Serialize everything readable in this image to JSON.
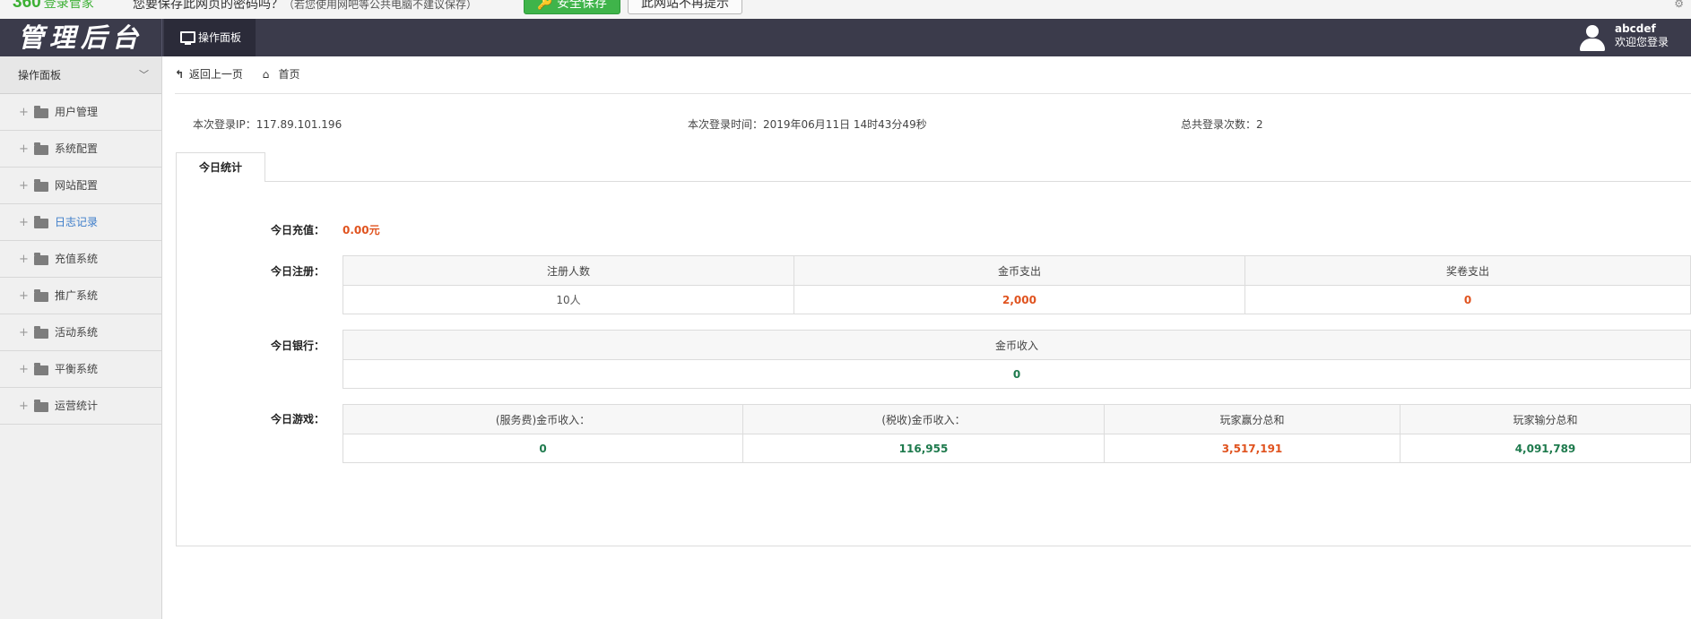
{
  "password_bar": {
    "brand": "360",
    "brand_sub": "登录管家",
    "message": "您要保存此网页的密码吗？",
    "note": "（若您使用网吧等公共电脑不建议保存）",
    "save_button": "安全保存",
    "never_button": "此网站不再提示"
  },
  "header": {
    "logo_text": "管理后台",
    "tab_label": "操作面板",
    "username": "abcdef",
    "welcome": "欢迎您登录"
  },
  "sidebar": {
    "title": "操作面板",
    "items": [
      {
        "label": "用户管理"
      },
      {
        "label": "系统配置"
      },
      {
        "label": "网站配置"
      },
      {
        "label": "日志记录"
      },
      {
        "label": "充值系统"
      },
      {
        "label": "推广系统"
      },
      {
        "label": "活动系统"
      },
      {
        "label": "平衡系统"
      },
      {
        "label": "运营统计"
      }
    ]
  },
  "breadcrumb": {
    "back": "返回上一页",
    "home": "首页"
  },
  "login_info": {
    "ip": "本次登录IP：117.89.101.196",
    "time": "本次登录时间：2019年06月11日 14时43分49秒",
    "count": "总共登录次数：2"
  },
  "tab": {
    "label": "今日统计"
  },
  "stats": {
    "recharge": {
      "label": "今日充值：",
      "value": "0.00元"
    },
    "register": {
      "label": "今日注册：",
      "headers": [
        "注册人数",
        "金币支出",
        "奖卷支出"
      ],
      "values": [
        "10人",
        "2,000",
        "0"
      ]
    },
    "bank": {
      "label": "今日银行：",
      "headers": [
        "金币收入"
      ],
      "values": [
        "0"
      ]
    },
    "game": {
      "label": "今日游戏：",
      "headers": [
        "(服务费)金币收入：",
        "(税收)金币收入：",
        "玩家赢分总和",
        "玩家输分总和"
      ],
      "values": [
        "0",
        "116,955",
        "3,517,191",
        "4,091,789"
      ]
    }
  }
}
